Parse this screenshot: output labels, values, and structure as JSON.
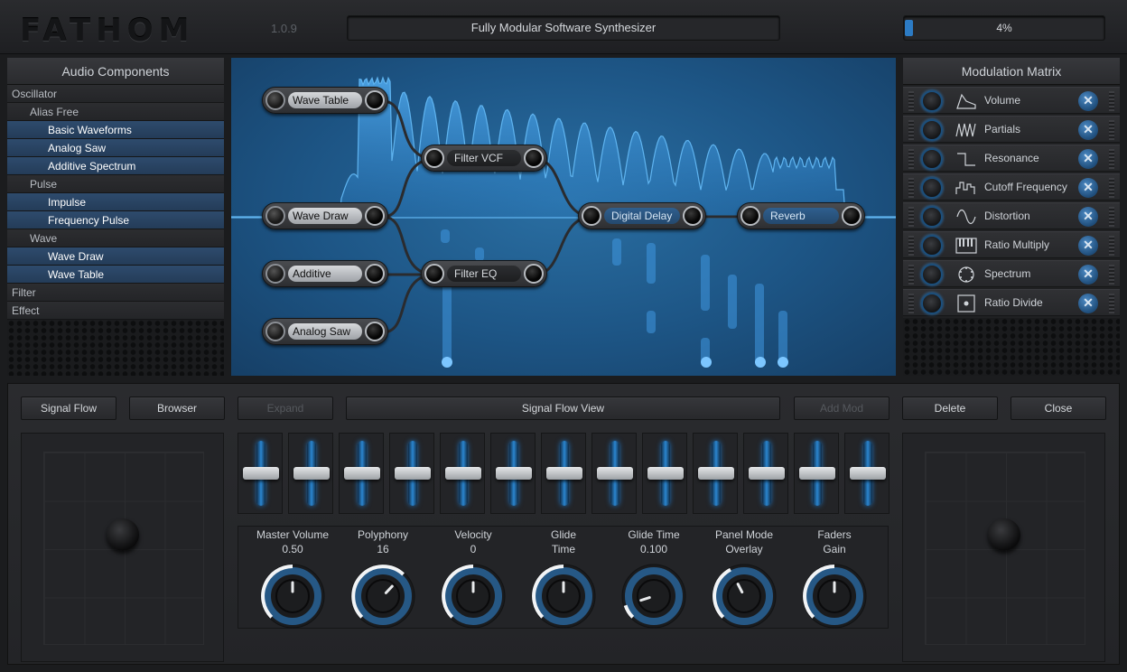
{
  "app": {
    "logo": "FATHOM",
    "version": "1.0.9",
    "subtitle": "Fully Modular Software Synthesizer",
    "cpu_text": "4%",
    "cpu_fraction": 0.04
  },
  "audio_components": {
    "title": "Audio Components",
    "items": [
      {
        "label": "Oscillator",
        "level": 0,
        "leaf": false
      },
      {
        "label": "Alias Free",
        "level": 1,
        "leaf": false
      },
      {
        "label": "Basic Waveforms",
        "level": 2,
        "leaf": true
      },
      {
        "label": "Analog Saw",
        "level": 2,
        "leaf": true
      },
      {
        "label": "Additive Spectrum",
        "level": 2,
        "leaf": true
      },
      {
        "label": "Pulse",
        "level": 1,
        "leaf": false
      },
      {
        "label": "Impulse",
        "level": 2,
        "leaf": true
      },
      {
        "label": "Frequency Pulse",
        "level": 2,
        "leaf": true
      },
      {
        "label": "Wave",
        "level": 1,
        "leaf": false
      },
      {
        "label": "Wave Draw",
        "level": 2,
        "leaf": true
      },
      {
        "label": "Wave Table",
        "level": 2,
        "leaf": true
      },
      {
        "label": "Filter",
        "level": 0,
        "leaf": false
      },
      {
        "label": "Effect",
        "level": 0,
        "leaf": false
      }
    ]
  },
  "signal_flow": {
    "nodes": {
      "wave_table": "Wave Table",
      "wave_draw": "Wave Draw",
      "additive": "Additive",
      "analog_saw": "Analog Saw",
      "filter_vcf": "Filter VCF",
      "filter_eq": "Filter EQ",
      "digital_delay": "Digital Delay",
      "reverb": "Reverb"
    }
  },
  "modulation_matrix": {
    "title": "Modulation Matrix",
    "rows": [
      {
        "label": "Volume",
        "icon": "envelope-icon"
      },
      {
        "label": "Partials",
        "icon": "partials-icon"
      },
      {
        "label": "Resonance",
        "icon": "square-wave-icon"
      },
      {
        "label": "Cutoff Frequency",
        "icon": "step-sequence-icon"
      },
      {
        "label": "Distortion",
        "icon": "sine-wave-icon"
      },
      {
        "label": "Ratio Multiply",
        "icon": "keyboard-icon"
      },
      {
        "label": "Spectrum",
        "icon": "dial-icon"
      },
      {
        "label": "Ratio Divide",
        "icon": "dot-square-icon"
      }
    ],
    "remove_glyph": "✕"
  },
  "toolbar": {
    "signal_flow": "Signal Flow",
    "browser": "Browser",
    "expand": "Expand",
    "view_title": "Signal Flow View",
    "add_mod": "Add Mod",
    "delete": "Delete",
    "close": "Close"
  },
  "faders": {
    "count": 13,
    "values": [
      0.5,
      0.5,
      0.5,
      0.5,
      0.5,
      0.5,
      0.5,
      0.5,
      0.5,
      0.5,
      0.5,
      0.5,
      0.5
    ]
  },
  "knobs": [
    {
      "label": "Master Volume",
      "value": "0.50",
      "fraction": 0.5
    },
    {
      "label": "Polyphony",
      "value": "16",
      "fraction": 0.66
    },
    {
      "label": "Velocity",
      "value": "0",
      "fraction": 0.5
    },
    {
      "label": "Glide",
      "value": "Time",
      "fraction": 0.5
    },
    {
      "label": "Glide Time",
      "value": "0.100",
      "fraction": 0.1
    },
    {
      "label": "Panel Mode",
      "value": "Overlay",
      "fraction": 0.4
    },
    {
      "label": "Faders",
      "value": "Gain",
      "fraction": 0.5
    }
  ],
  "colors": {
    "accent": "#2b86d0",
    "canvas_bg": "#1d5585",
    "leaf_bg": "#2e4b6d"
  }
}
